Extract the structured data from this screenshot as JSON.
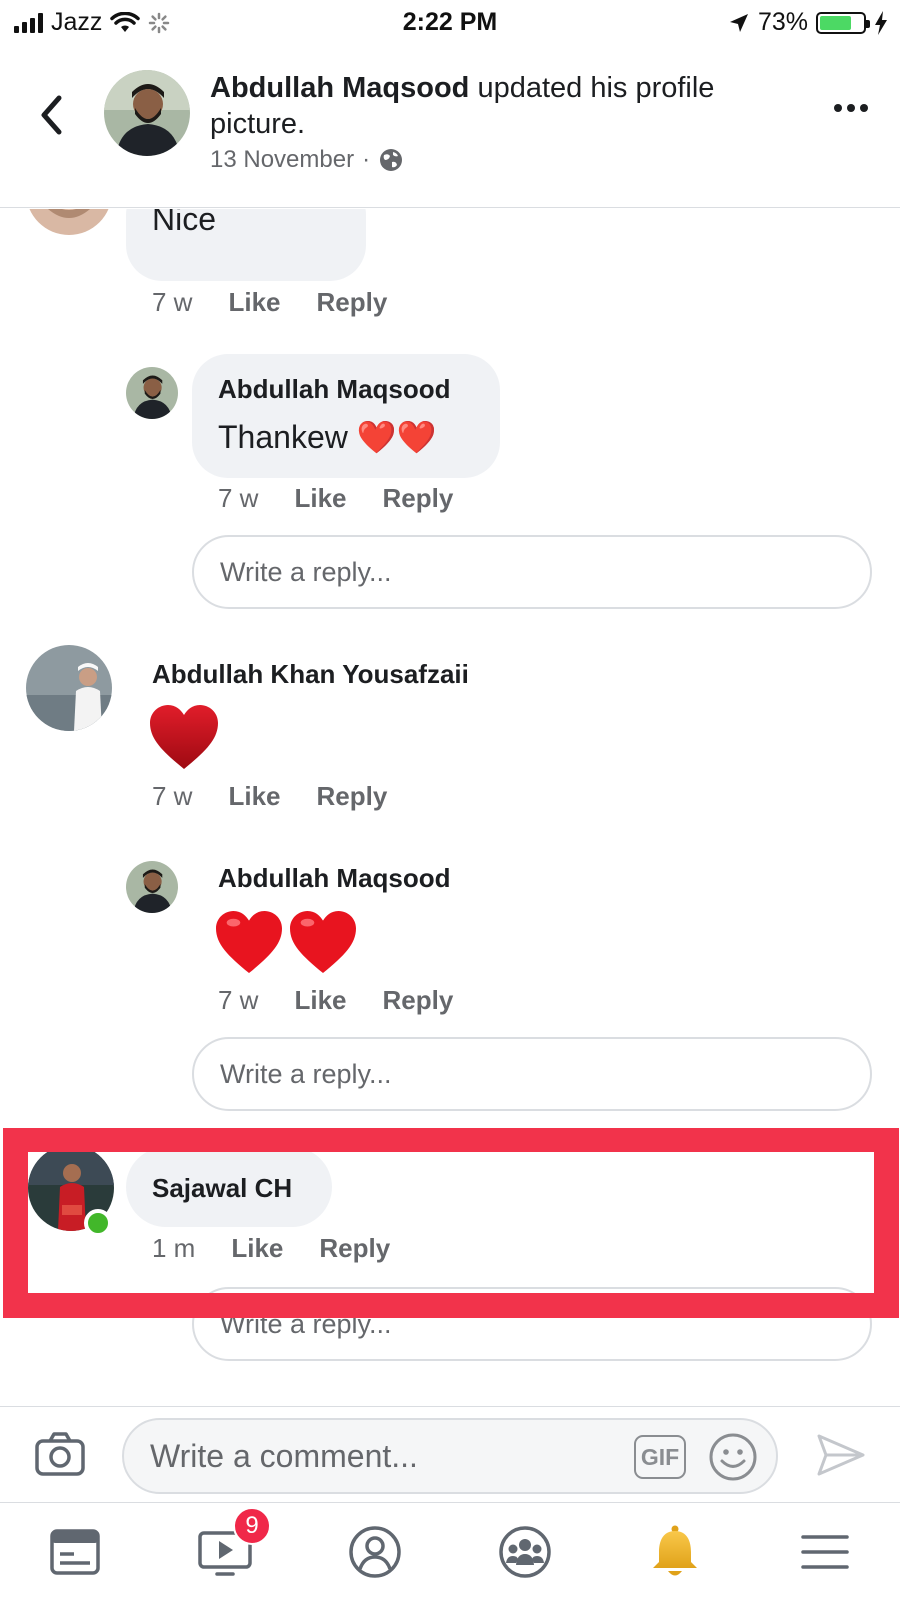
{
  "status_bar": {
    "carrier": "Jazz",
    "time": "2:22 PM",
    "battery_percent": "73%",
    "battery_level": 0.73
  },
  "post": {
    "author": "Abdullah Maqsood",
    "action": "updated his profile picture.",
    "date": "13 November",
    "separator": "·"
  },
  "comments": [
    {
      "text": "Nice",
      "time": "7 w",
      "like_label": "Like",
      "reply_label": "Reply"
    },
    {
      "author": "Abdullah Maqsood",
      "text": "Thankew",
      "emoji": "❤️❤️",
      "time": "7 w",
      "like_label": "Like",
      "reply_label": "Reply",
      "reply_placeholder": "Write a reply..."
    },
    {
      "author": "Abdullah Khan Yousafzaii",
      "emoji": "❤️",
      "time": "7 w",
      "like_label": "Like",
      "reply_label": "Reply"
    },
    {
      "author": "Abdullah Maqsood",
      "emoji": "❤️❤️",
      "time": "7 w",
      "like_label": "Like",
      "reply_label": "Reply",
      "reply_placeholder": "Write a reply..."
    },
    {
      "author": "Sajawal CH",
      "time": "1 m",
      "like_label": "Like",
      "reply_label": "Reply",
      "reply_placeholder": "Write a reply...",
      "online": true
    }
  ],
  "comment_bar": {
    "placeholder": "Write a comment...",
    "gif_label": "GIF"
  },
  "tab_bar": {
    "tabs": [
      "news-feed",
      "watch",
      "profile",
      "groups",
      "notifications",
      "menu"
    ],
    "watch_badge": "9"
  },
  "colors": {
    "highlight": "#f2334b",
    "bubble": "#f0f2f5",
    "secondary_text": "#65676b",
    "online": "#42b72a",
    "badge": "#f02849"
  }
}
